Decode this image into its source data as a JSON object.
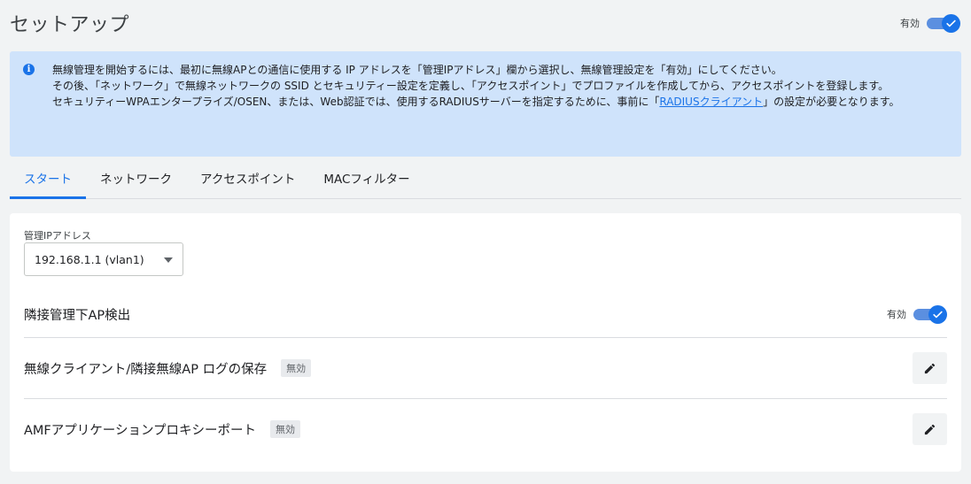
{
  "header": {
    "title": "セットアップ",
    "toggle_label": "有効",
    "toggle_on": true
  },
  "info": {
    "line1": "無線管理を開始するには、最初に無線APとの通信に使用する IP アドレスを「管理IPアドレス」欄から選択し、無線管理設定を「有効」にしてください。",
    "line2": "その後、「ネットワーク」で無線ネットワークの SSID とセキュリティー設定を定義し、「アクセスポイント」でプロファイルを作成してから、アクセスポイントを登録します。",
    "line3_before": "セキュリティーWPAエンタープライズ/OSEN、または、Web認証では、使用するRADIUSサーバーを指定するために、事前に「",
    "line3_link": "RADIUSクライアント",
    "line3_after": "」の設定が必要となります。"
  },
  "tabs": [
    {
      "label": "スタート",
      "active": true
    },
    {
      "label": "ネットワーク",
      "active": false
    },
    {
      "label": "アクセスポイント",
      "active": false
    },
    {
      "label": "MACフィルター",
      "active": false
    }
  ],
  "management_ip": {
    "label": "管理IPアドレス",
    "value": "192.168.1.1 (vlan1)"
  },
  "rows": {
    "neighbor_ap": {
      "title": "隣接管理下AP検出",
      "toggle_label": "有効",
      "toggle_on": true
    },
    "log_save": {
      "title": "無線クライアント/隣接無線AP ログの保存",
      "badge": "無効"
    },
    "amf_proxy": {
      "title": "AMFアプリケーションプロキシーポート",
      "badge": "無効"
    }
  },
  "colors": {
    "accent": "#1a73e8",
    "info_bg": "#cfe3fb",
    "page_bg": "#f1f3f4"
  },
  "icons": {
    "info": "info-icon",
    "edit": "pencil-icon",
    "dropdown": "caret-down-icon",
    "check": "check-icon"
  }
}
